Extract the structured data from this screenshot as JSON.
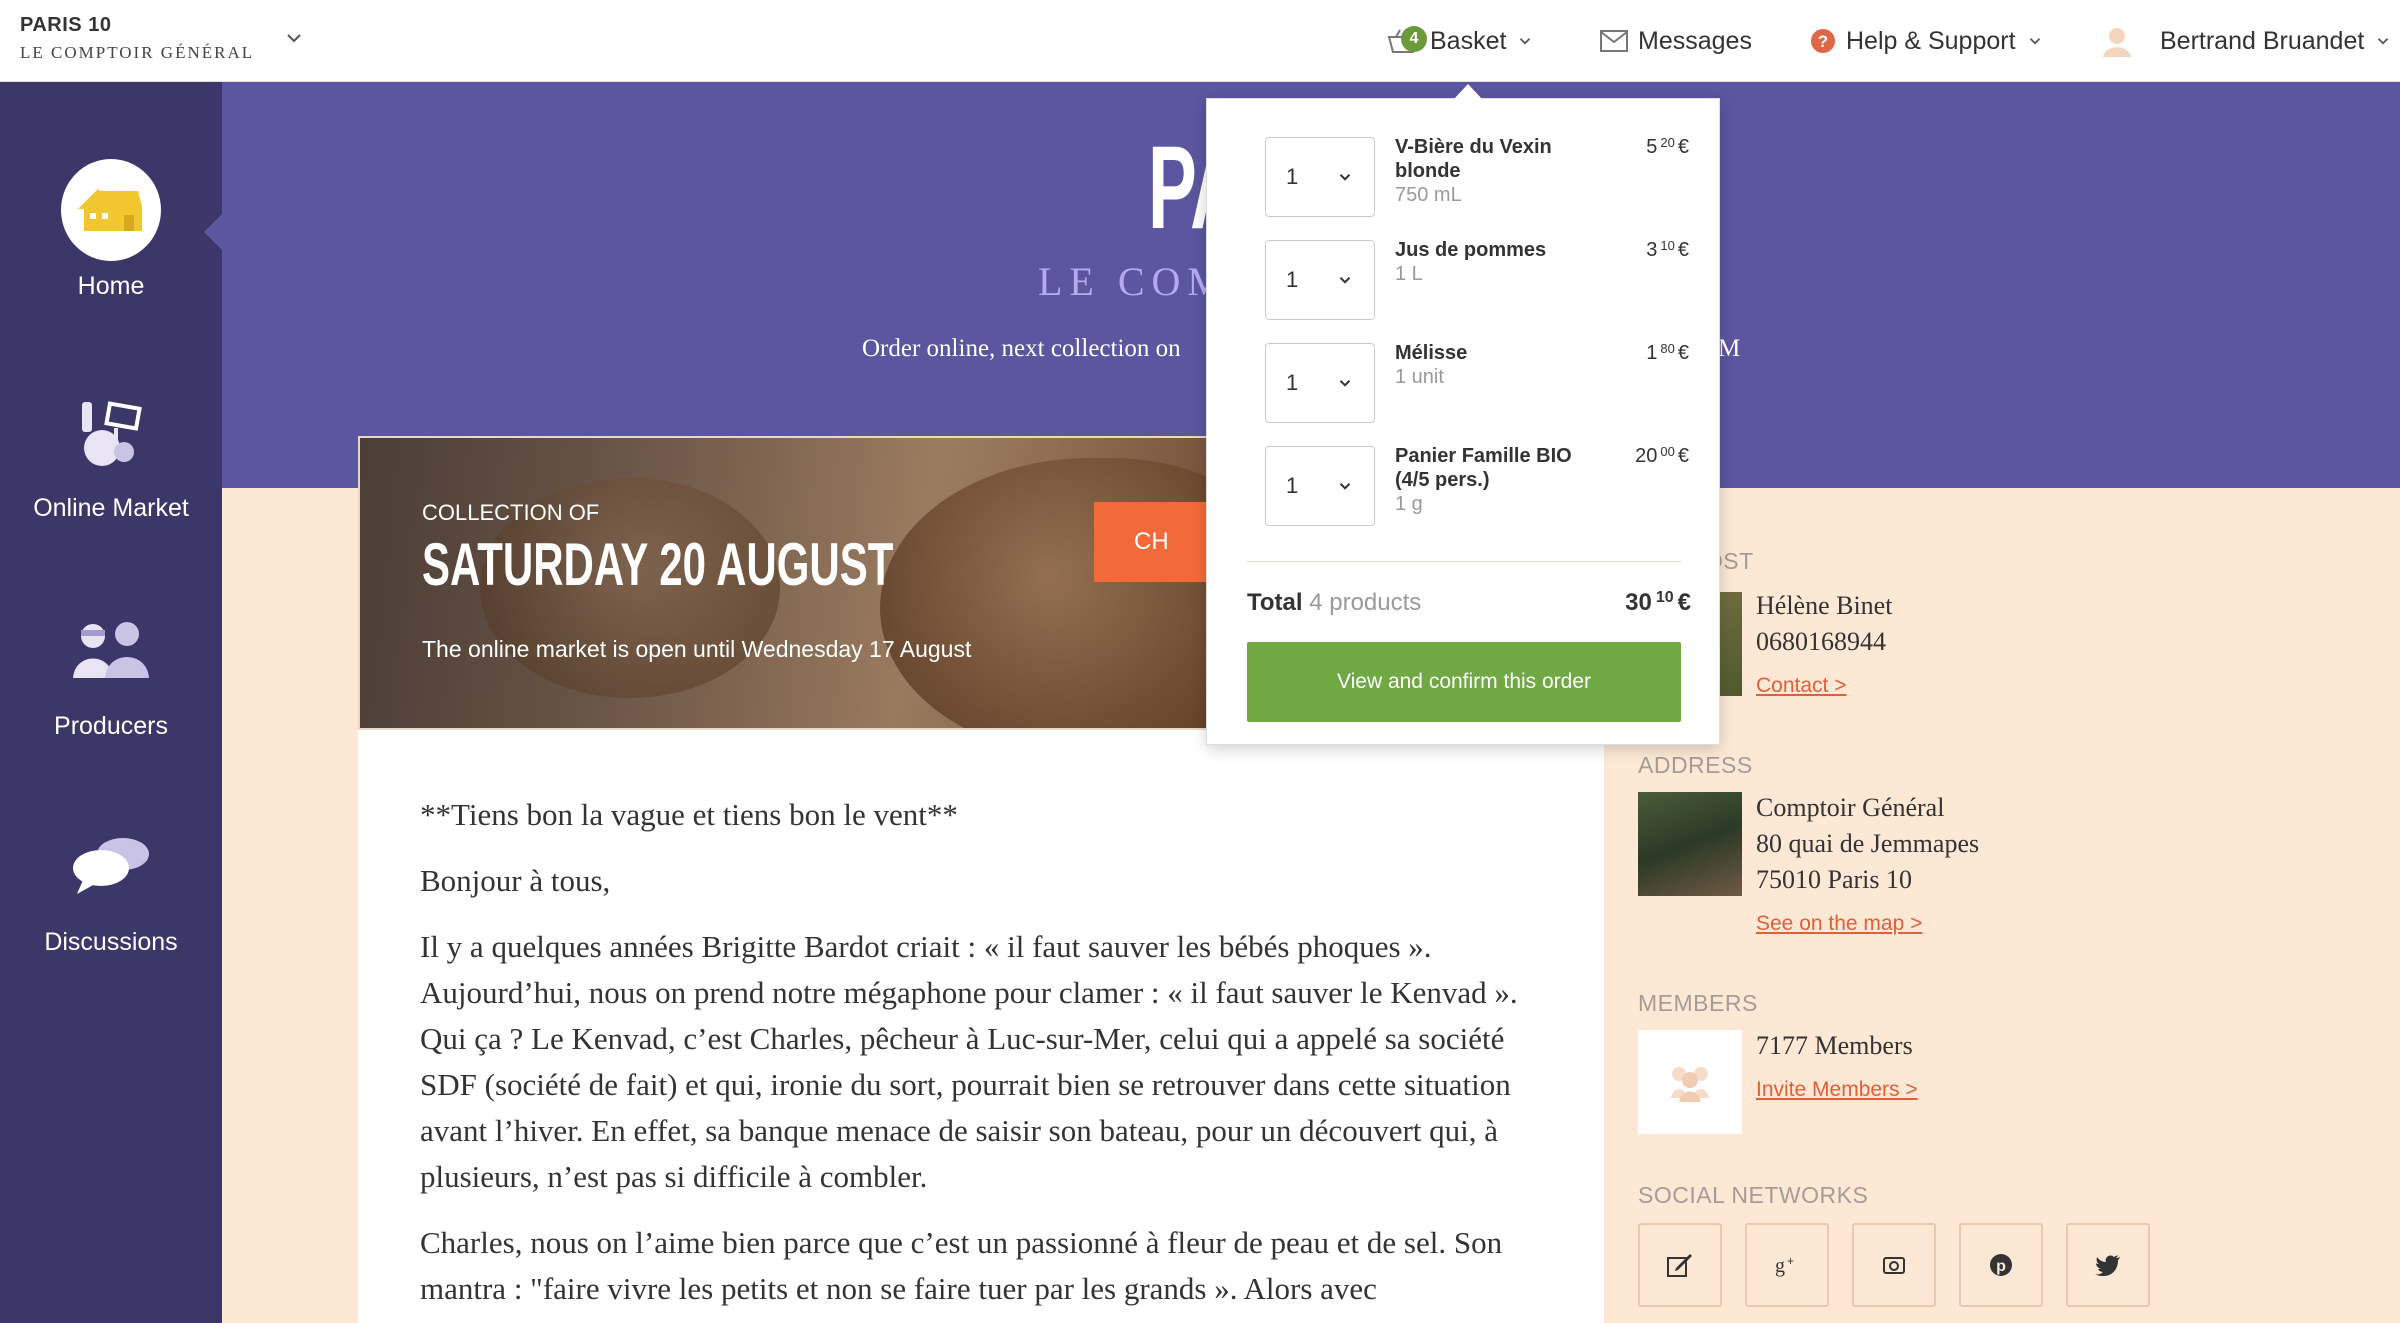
{
  "brand": {
    "name": "PARIS 10",
    "subtitle": "LE COMPTOIR GÉNÉRAL"
  },
  "topnav": {
    "basket": {
      "label": "Basket",
      "badge": "4"
    },
    "messages": {
      "label": "Messages"
    },
    "help": {
      "label": "Help & Support"
    },
    "user": {
      "name": "Bertrand Bruandet"
    }
  },
  "sidebar": {
    "items": [
      {
        "label": "Home",
        "icon": "home-icon"
      },
      {
        "label": "Online Market",
        "icon": "market-icon"
      },
      {
        "label": "Producers",
        "icon": "producers-icon"
      },
      {
        "label": "Discussions",
        "icon": "discussions-icon"
      }
    ]
  },
  "hero": {
    "title": "PA",
    "subtitle": "LE COM",
    "order_text": "Order online, next collection on",
    "order_end": "M"
  },
  "banner": {
    "collection_of": "COLLECTION OF",
    "date": "SATURDAY 20 AUGUST",
    "market_open": "The online market is open until Wednesday 17 August",
    "cta": "CH"
  },
  "article": {
    "paragraphs": [
      "**Tiens bon la vague et tiens bon le vent**",
      "Bonjour à tous,",
      "Il y a quelques années Brigitte Bardot criait : « il faut sauver les bébés phoques ». Aujourd’hui, nous on prend notre mégaphone pour clamer : « il faut sauver le Kenvad ». Qui ça ? Le Kenvad, c’est Charles, pêcheur à Luc-sur-Mer, celui qui a appelé sa société SDF (société de fait) et qui, ironie du sort, pourrait bien se retrouver dans cette situation avant l’hiver. En effet, sa banque menace de saisir son bateau, pour un découvert qui, à plusieurs, n’est pas si difficile à combler.",
      "Charles, nous on l’aime bien parce que c’est un passionné à fleur de peau et de sel. Son mantra : \"faire vivre les petits et non se faire tuer par les grands ». Alors avec"
    ]
  },
  "right": {
    "host": {
      "label": "BLY HOST",
      "name": "Hélène Binet",
      "phone": "0680168944",
      "link": "Contact >"
    },
    "address": {
      "label": "ADDRESS",
      "line1": "Comptoir Général",
      "line2": "80 quai de Jemmapes",
      "line3": "75010 Paris 10",
      "link": "See on the map >"
    },
    "members": {
      "label": "MEMBERS",
      "count": "7177 Members",
      "link": "Invite Members >"
    },
    "social": {
      "label": "SOCIAL NETWORKS",
      "icons": [
        "blog-icon",
        "google-plus-icon",
        "instagram-icon",
        "pinterest-icon",
        "twitter-icon"
      ]
    }
  },
  "basket_dropdown": {
    "items": [
      {
        "qty": "1",
        "name": "V-Bière du Vexin blonde",
        "size": "750 mL",
        "price_int": "5",
        "price_dec": "20",
        "currency": "€"
      },
      {
        "qty": "1",
        "name": "Jus de pommes",
        "size": "1 L",
        "price_int": "3",
        "price_dec": "10",
        "currency": "€"
      },
      {
        "qty": "1",
        "name": "Mélisse",
        "size": "1 unit",
        "price_int": "1",
        "price_dec": "80",
        "currency": "€"
      },
      {
        "qty": "1",
        "name": "Panier Famille BIO (4/5 pers.)",
        "size": "1 g",
        "price_int": "20",
        "price_dec": "00",
        "currency": "€"
      }
    ],
    "total_label": "Total",
    "total_count": "4 products",
    "total_int": "30",
    "total_dec": "10",
    "total_currency": "€",
    "confirm": "View and confirm this order"
  },
  "colors": {
    "sidebar": "#3d3669",
    "hero": "#5c56a0",
    "page_bg": "#fde8d6",
    "accent_orange": "#e0603a",
    "confirm_green": "#70a844"
  }
}
